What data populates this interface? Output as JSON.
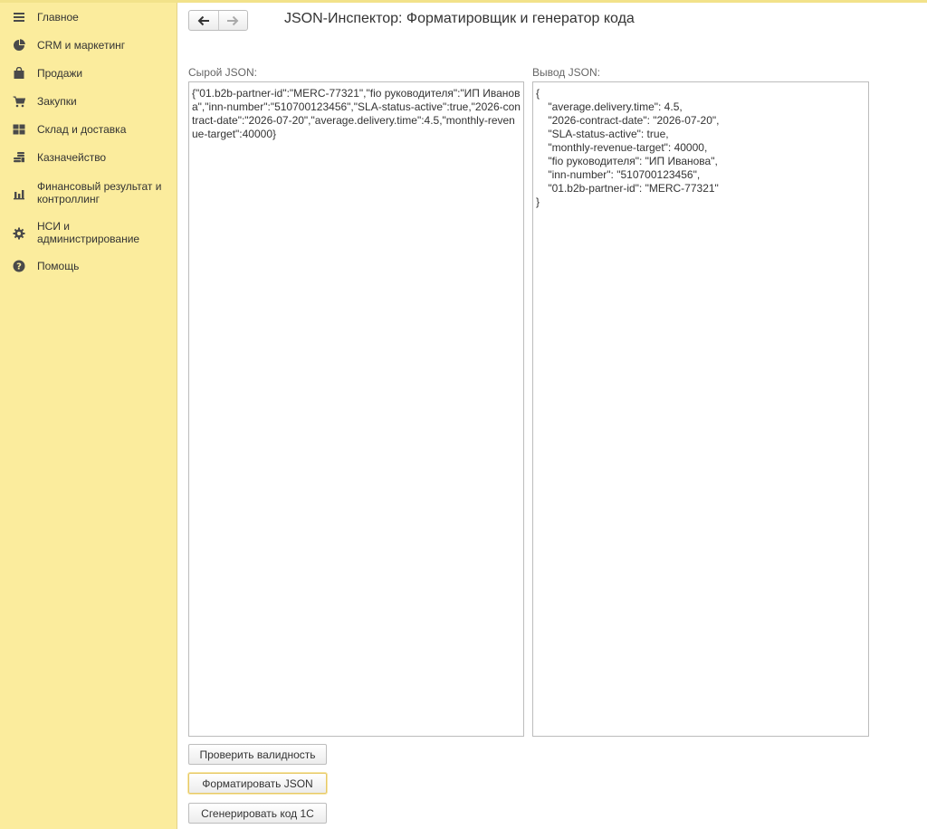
{
  "sidebar": {
    "items": [
      {
        "label": "Главное",
        "icon": "menu-lines-icon"
      },
      {
        "label": "CRM и маркетинг",
        "icon": "pie-chart-icon"
      },
      {
        "label": "Продажи",
        "icon": "shopping-bag-icon"
      },
      {
        "label": "Закупки",
        "icon": "shopping-cart-icon"
      },
      {
        "label": "Склад и доставка",
        "icon": "warehouse-grid-icon"
      },
      {
        "label": "Казначейство",
        "icon": "coins-stack-icon"
      },
      {
        "label": "Финансовый результат и контроллинг",
        "icon": "bar-chart-icon"
      },
      {
        "label": "НСИ и администрирование",
        "icon": "gear-icon"
      },
      {
        "label": "Помощь",
        "icon": "help-circle-icon"
      }
    ]
  },
  "header": {
    "title": "JSON-Инспектор: Форматировщик и генератор кода",
    "back_icon": "arrow-left-icon",
    "forward_icon": "arrow-right-icon"
  },
  "raw_json": {
    "label": "Сырой JSON:",
    "value": "{\"01.b2b-partner-id\":\"MERC-77321\",\"fio руководителя\":\"ИП Иванова\",\"inn-number\":\"510700123456\",\"SLA-status-active\":true,\"2026-contract-date\":\"2026-07-20\",\"average.delivery.time\":4.5,\"monthly-revenue-target\":40000}"
  },
  "output_json": {
    "label": "Вывод JSON:",
    "value": "{\n    \"average.delivery.time\": 4.5,\n    \"2026-contract-date\": \"2026-07-20\",\n    \"SLA-status-active\": true,\n    \"monthly-revenue-target\": 40000,\n    \"fio руководителя\": \"ИП Иванова\",\n    \"inn-number\": \"510700123456\",\n    \"01.b2b-partner-id\": \"MERC-77321\"\n}"
  },
  "buttons": {
    "validate": "Проверить валидность",
    "format": "Форматировать JSON",
    "generate": "Сгенерировать код 1С"
  },
  "colors": {
    "sidebar_bg": "#fbec9d",
    "top_accent": "#f2e28a",
    "icon": "#4a4a4a"
  }
}
